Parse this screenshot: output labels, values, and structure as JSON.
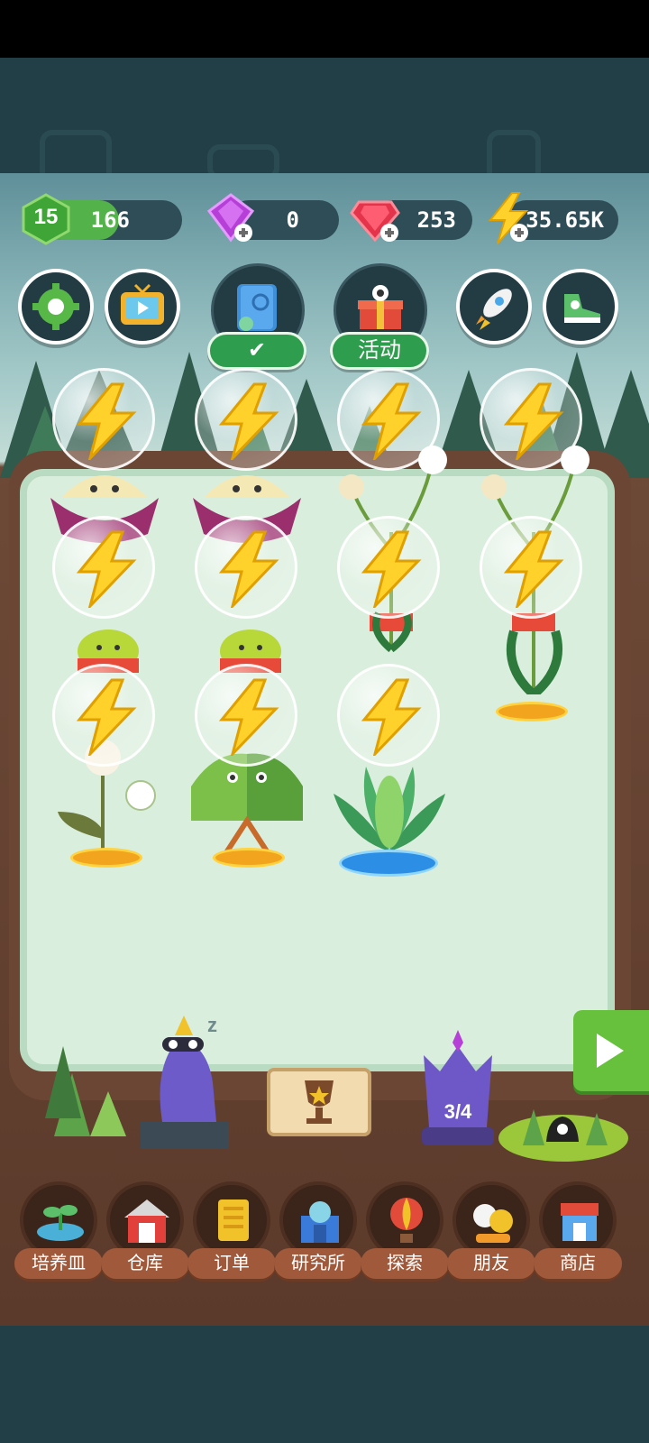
{
  "resources": {
    "level": "15",
    "xp": "166",
    "xp_fraction": 0.55,
    "purple_gems": "0",
    "red_gems": "253",
    "energy": "35.65K"
  },
  "top_buttons": {
    "activity_label": "活动",
    "book_check": "✔"
  },
  "board": {
    "energy_bubbles": 11,
    "pots": [
      "gold",
      "gold",
      "blue",
      "gold",
      "gold",
      "gold"
    ]
  },
  "bottom": {
    "purple_statue_count": "3/4",
    "sleep_mark": "z"
  },
  "nav": [
    {
      "label": "培养皿",
      "icon": "sprout-dish-icon"
    },
    {
      "label": "仓库",
      "icon": "barn-icon"
    },
    {
      "label": "订单",
      "icon": "scroll-icon"
    },
    {
      "label": "研究所",
      "icon": "lab-building-icon"
    },
    {
      "label": "探索",
      "icon": "hot-air-balloon-icon"
    },
    {
      "label": "朋友",
      "icon": "friends-icon"
    },
    {
      "label": "商店",
      "icon": "shop-icon"
    }
  ],
  "colors": {
    "xp_green": "#54b24a",
    "purple_gem": "#b63fd8",
    "red_gem": "#e3344b",
    "energy_yellow": "#ffd12a",
    "nav_brown": "#a0593a"
  }
}
